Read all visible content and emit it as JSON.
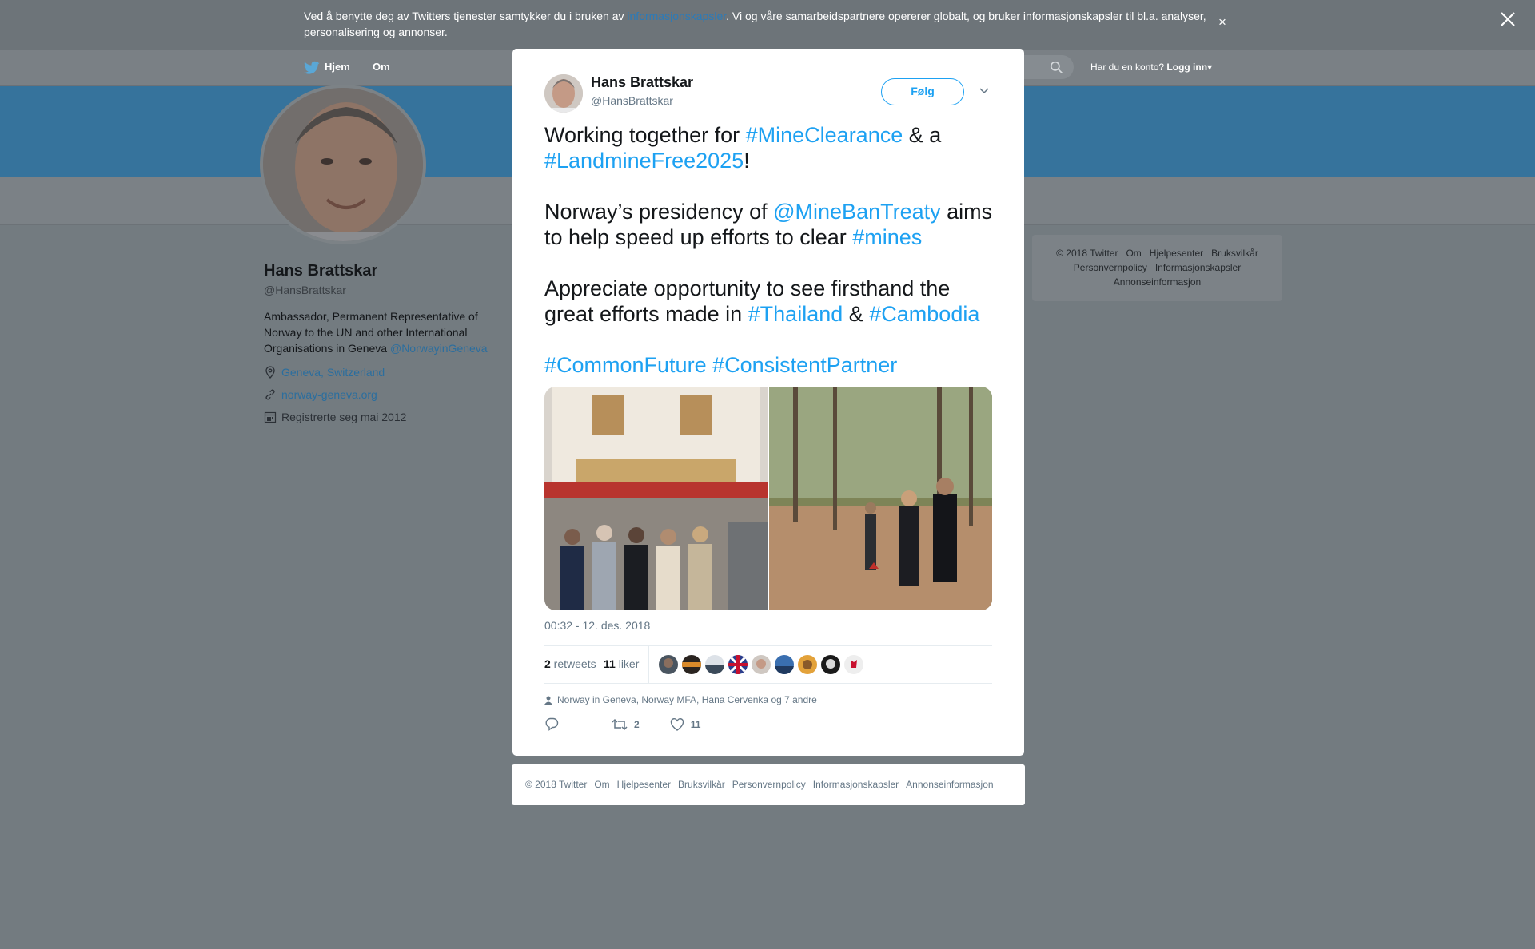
{
  "cookie_banner": {
    "text_before": "Ved å benytte deg av Twitters tjenester samtykker du i bruken av ",
    "link": "informasjonskapsler",
    "text_after": ". Vi og våre samarbeidspartnere opererer globalt, og bruker informasjonskapsler til bl.a. analyser, personalisering og annonser.",
    "close": "×"
  },
  "nav": {
    "home": "Hjem",
    "about": "Om",
    "account_prompt": "Har du en konto?",
    "login": "Logg inn",
    "login_caret": "▾"
  },
  "profile": {
    "name": "Hans Brattskar",
    "handle": "@HansBrattskar",
    "bio": "Ambassador, Permanent Representative of Norway to the UN and other International Organisations in Geneva ",
    "bio_link": "@NorwayinGeneva",
    "location": "Geneva, Switzerland",
    "website": "norway-geneva.org",
    "joined": "Registrerte seg mai 2012"
  },
  "side_footer": {
    "items": [
      "© 2018 Twitter",
      "Om",
      "Hjelpesenter",
      "Bruksvilkår",
      "Personvernpolicy",
      "Informasjonskapsler",
      "Annonseinformasjon"
    ]
  },
  "tweet": {
    "author_name": "Hans Brattskar",
    "author_handle": "@HansBrattskar",
    "follow_label": "Følg",
    "p1": {
      "a": "Working together for ",
      "tag1": "#MineClearance",
      "b": " & a ",
      "tag2": "#LandmineFree2025",
      "c": "!"
    },
    "p2": {
      "a": "Norway’s presidency of ",
      "mention": "@MineBanTreaty",
      "b": " aims to help speed up efforts to clear ",
      "tag": "#mines"
    },
    "p3": {
      "a": "Appreciate opportunity to see firsthand the great efforts made in ",
      "tag1": "#Thailand",
      "b": " & ",
      "tag2": "#Cambodia"
    },
    "p4": {
      "tag1": "#CommonFuture",
      "sep": " ",
      "tag2": "#ConsistentPartner"
    },
    "timestamp": "00:32 - 12. des. 2018",
    "retweets_count": "2",
    "retweets_label": " retweets",
    "likes_count": "11",
    "likes_label": " liker",
    "liked_by": "Norway in Geneva, Norway MFA, Hana Cervenka og 7 andre",
    "action_retweet_count": "2",
    "action_like_count": "11"
  },
  "bottom_footer": {
    "items": [
      "© 2018 Twitter",
      "Om",
      "Hjelpesenter",
      "Bruksvilkår",
      "Personvernpolicy",
      "Informasjonskapsler",
      "Annonseinformasjon"
    ]
  },
  "colors": {
    "accent": "#1da1f2",
    "overlay": "#737b80",
    "banner": "#36739c"
  }
}
